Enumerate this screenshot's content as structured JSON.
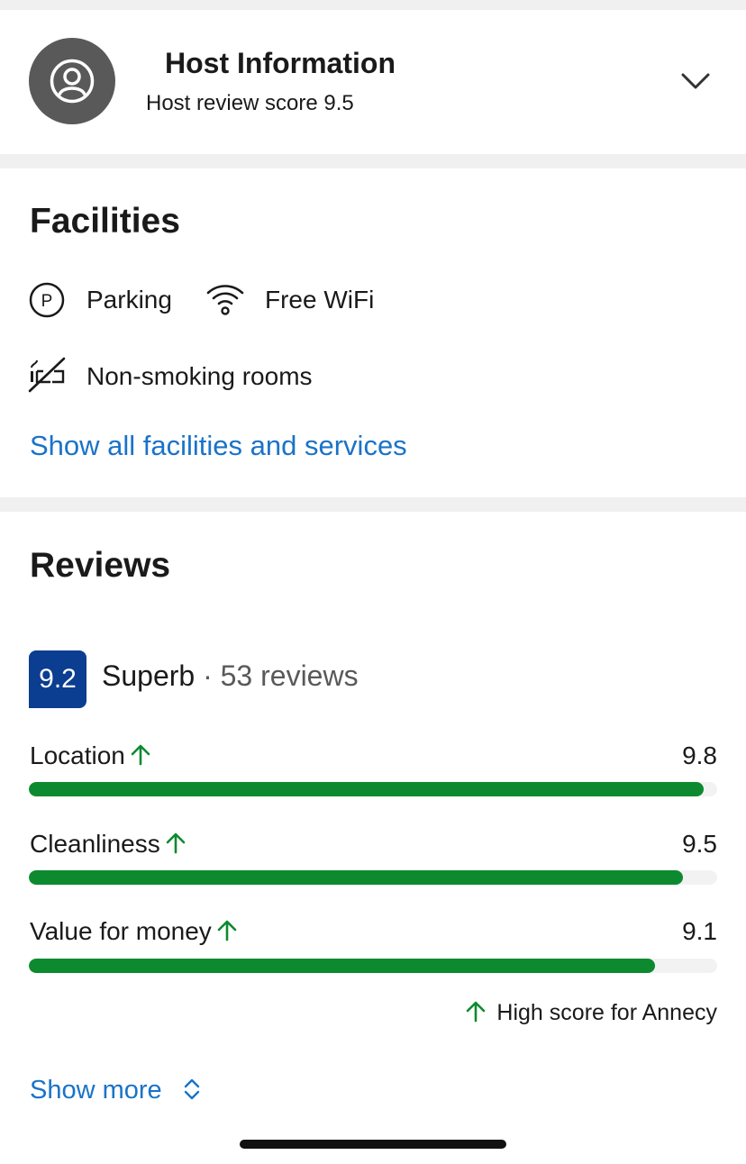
{
  "host": {
    "title": "Host Information",
    "review_score_text": "Host review score 9.5",
    "icons": {
      "avatar": "user-circle-icon",
      "expand": "chevron-down-icon"
    }
  },
  "facilities": {
    "title": "Facilities",
    "items": [
      {
        "label": "Parking",
        "icon": "parking-icon"
      },
      {
        "label": "Free WiFi",
        "icon": "wifi-icon"
      },
      {
        "label": "Non-smoking rooms",
        "icon": "no-smoking-icon"
      }
    ],
    "show_all_label": "Show all facilities and services"
  },
  "reviews": {
    "title": "Reviews",
    "score": "9.2",
    "rating_word": "Superb",
    "separator": "·",
    "count_text": "53 reviews",
    "categories": [
      {
        "label": "Location",
        "score": "9.8",
        "fill": 0.98,
        "high": true
      },
      {
        "label": "Cleanliness",
        "score": "9.5",
        "fill": 0.95,
        "high": true
      },
      {
        "label": "Value for money",
        "score": "9.1",
        "fill": 0.91,
        "high": true
      }
    ],
    "high_score_note": "High score for Annecy",
    "show_more_label": "Show more"
  },
  "colors": {
    "accent_link": "#1a73c8",
    "score_badge": "#0b3d91",
    "bar_fill": "#0d8a2f",
    "bar_track": "#f2f2f2",
    "avatar_bg": "#595959"
  }
}
